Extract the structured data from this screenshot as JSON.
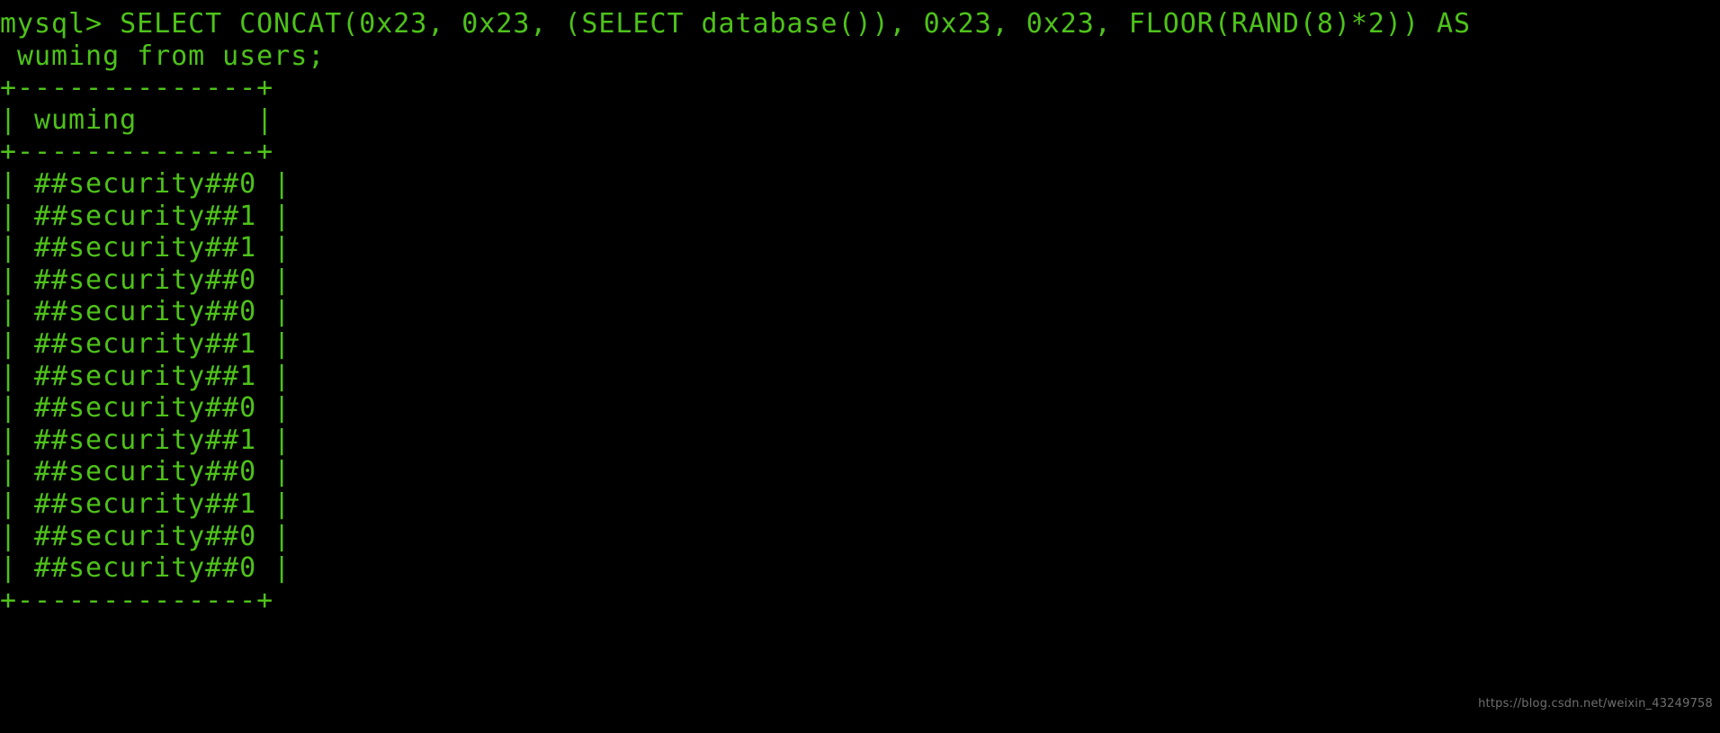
{
  "terminal": {
    "background_color": "#000000",
    "text_color": "#4ec21a",
    "prompt": "mysql>",
    "command_line_1": "mysql> SELECT CONCAT(0x23, 0x23, (SELECT database()), 0x23, 0x23, FLOOR(RAND(8)*2)) AS",
    "command_line_2": " wuming from users;",
    "table": {
      "top_border": "+--------------+",
      "header_row": "| wuming       |",
      "header_separator": "+--------------+",
      "bottom_border": "+--------------+",
      "column_header": "wuming",
      "rows": [
        "| ##security##0 |",
        "| ##security##1 |",
        "| ##security##1 |",
        "| ##security##0 |",
        "| ##security##0 |",
        "| ##security##1 |",
        "| ##security##1 |",
        "| ##security##0 |",
        "| ##security##1 |",
        "| ##security##0 |",
        "| ##security##1 |",
        "| ##security##0 |",
        "| ##security##0 |"
      ],
      "row_values": [
        "##security##0",
        "##security##1",
        "##security##1",
        "##security##0",
        "##security##0",
        "##security##1",
        "##security##1",
        "##security##0",
        "##security##1",
        "##security##0",
        "##security##1",
        "##security##0",
        "##security##0"
      ],
      "database_name": "security",
      "row_count": 13
    },
    "all_lines": [
      "mysql> SELECT CONCAT(0x23, 0x23, (SELECT database()), 0x23, 0x23, FLOOR(RAND(8)*2)) AS",
      " wuming from users;",
      "+--------------+",
      "| wuming       |",
      "+--------------+",
      "| ##security##0 |",
      "| ##security##1 |",
      "| ##security##1 |",
      "| ##security##0 |",
      "| ##security##0 |",
      "| ##security##1 |",
      "| ##security##1 |",
      "| ##security##0 |",
      "| ##security##1 |",
      "| ##security##0 |",
      "| ##security##1 |",
      "| ##security##0 |",
      "| ##security##0 |",
      "+--------------+"
    ]
  },
  "watermark": {
    "text": "https://blog.csdn.net/weixin_43249758"
  }
}
